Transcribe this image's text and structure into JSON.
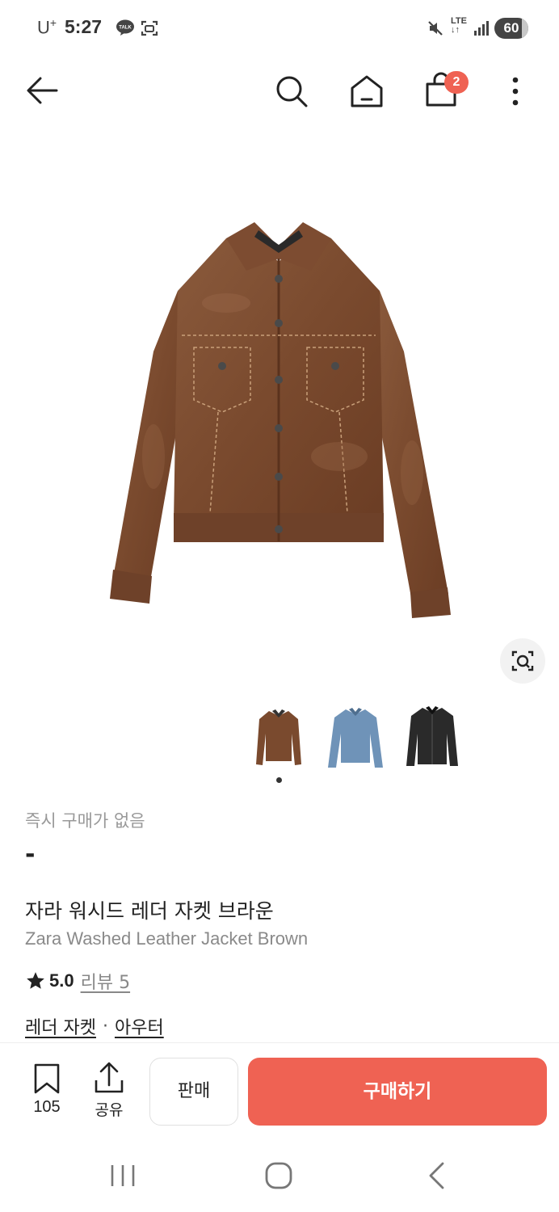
{
  "status_bar": {
    "carrier": "U",
    "carrier_plus": "+",
    "time": "5:27",
    "network": "LTE",
    "battery": "60",
    "icons": [
      "talk-icon",
      "screen-capture-icon",
      "mute-icon",
      "signal-icon"
    ]
  },
  "app_bar": {
    "icons": [
      "back-arrow-icon",
      "search-icon",
      "home-icon",
      "shopping-bag-icon",
      "more-vertical-icon"
    ],
    "cart_count": "2"
  },
  "product": {
    "image_icon": "brown-leather-jacket-image",
    "thumbnails": [
      {
        "name": "brown",
        "color": "#7a4a2e"
      },
      {
        "name": "blue",
        "color": "#6f93b8"
      },
      {
        "name": "black",
        "color": "#2a2a2a"
      }
    ],
    "instant_buy_status": "즉시 구매가 없음",
    "price": "-",
    "title_ko": "자라 워시드 레더 자켓 브라운",
    "title_en": "Zara Washed Leather Jacket Brown",
    "rating": "5.0",
    "review_label": "리뷰 5",
    "categories": [
      "레더 자켓",
      "아우터"
    ],
    "category_separator": "·"
  },
  "action_bar": {
    "bookmark_count": "105",
    "share_label": "공유",
    "sell_label": "판매",
    "buy_label": "구매하기",
    "accent_color": "#ef6253"
  },
  "nav_bar": {
    "icons": [
      "recent-apps-icon",
      "home-circle-icon",
      "back-chevron-icon"
    ]
  }
}
